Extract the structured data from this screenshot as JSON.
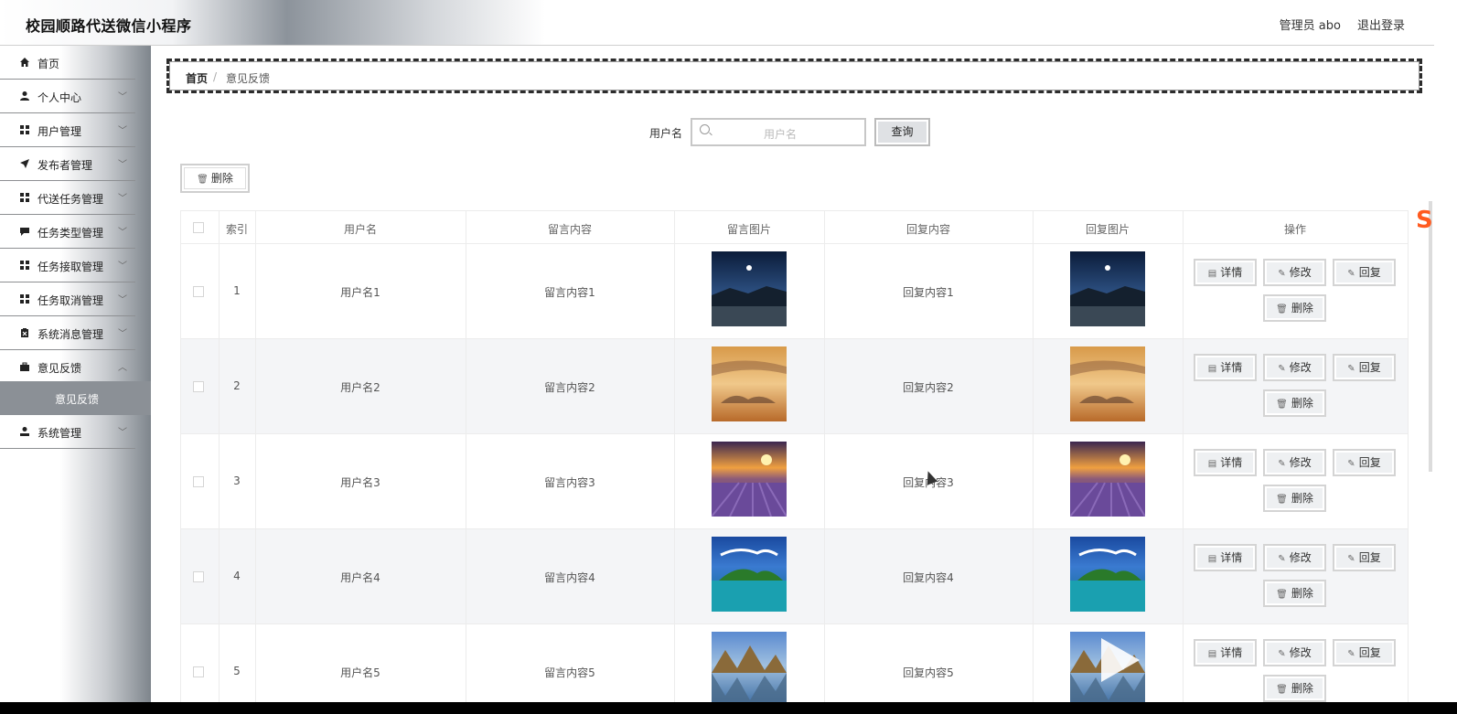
{
  "app": {
    "title": "校园顺路代送微信小程序"
  },
  "header": {
    "user": "管理员 abo",
    "logout": "退出登录"
  },
  "sidebar": {
    "items": [
      {
        "label": "首页",
        "icon": "home-icon"
      },
      {
        "label": "个人中心",
        "icon": "user-icon"
      },
      {
        "label": "用户管理",
        "icon": "grid-icon"
      },
      {
        "label": "发布者管理",
        "icon": "send-icon"
      },
      {
        "label": "代送任务管理",
        "icon": "grid-icon"
      },
      {
        "label": "任务类型管理",
        "icon": "chat-icon"
      },
      {
        "label": "任务接取管理",
        "icon": "grid-icon"
      },
      {
        "label": "任务取消管理",
        "icon": "grid-icon"
      },
      {
        "label": "系统消息管理",
        "icon": "clipboard-icon"
      },
      {
        "label": "意见反馈",
        "icon": "briefcase-icon"
      },
      {
        "label": "系统管理",
        "icon": "person-icon"
      }
    ],
    "submenu_label": "意见反馈"
  },
  "breadcrumb": {
    "home": "首页",
    "sep": "/",
    "current": "意见反馈"
  },
  "search": {
    "label": "用户名",
    "placeholder": "用户名",
    "button": "查询"
  },
  "toolbar": {
    "delete_label": "删除"
  },
  "table": {
    "headers": [
      "索引",
      "用户名",
      "留言内容",
      "留言图片",
      "回复内容",
      "回复图片",
      "操作"
    ],
    "rows": [
      {
        "index": "1",
        "username": "用户名1",
        "content": "留言内容1",
        "reply": "回复内容1",
        "image": "night-lake"
      },
      {
        "index": "2",
        "username": "用户名2",
        "content": "留言内容2",
        "reply": "回复内容2",
        "image": "sunset-clouds"
      },
      {
        "index": "3",
        "username": "用户名3",
        "content": "留言内容3",
        "reply": "回复内容3",
        "image": "lavender-field"
      },
      {
        "index": "4",
        "username": "用户名4",
        "content": "留言内容4",
        "reply": "回复内容4",
        "image": "tropical-island"
      },
      {
        "index": "5",
        "username": "用户名5",
        "content": "留言内容5",
        "reply": "回复内容5",
        "image": "mountain-lake"
      }
    ],
    "actions": {
      "detail": "详情",
      "edit": "修改",
      "reply": "回复",
      "delete": "删除"
    }
  }
}
